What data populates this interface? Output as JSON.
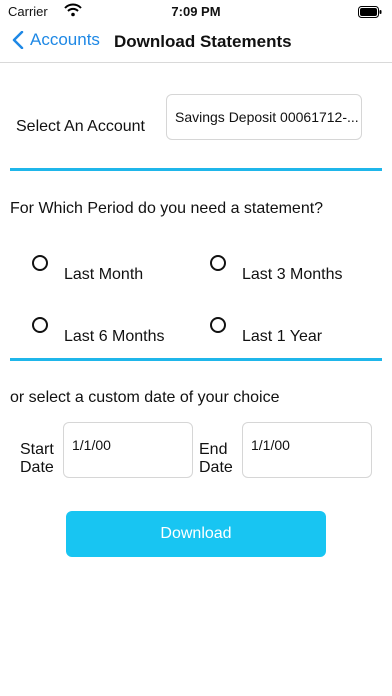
{
  "status_bar": {
    "carrier": "Carrier",
    "time": "7:09 PM"
  },
  "nav": {
    "back_label": "Accounts",
    "title": "Download Statements"
  },
  "account": {
    "label": "Select An Account",
    "value": "Savings Deposit 00061712-..."
  },
  "period": {
    "title": "For Which Period do you need a statement?",
    "options": [
      {
        "label": "Last Month",
        "selected": false
      },
      {
        "label": "Last 3 Months",
        "selected": false
      },
      {
        "label": "Last 6 Months",
        "selected": false
      },
      {
        "label": "Last 1 Year",
        "selected": false
      }
    ]
  },
  "custom": {
    "title": "or select a custom date of your choice",
    "start_label_line1": "Start",
    "start_label_line2": "Date",
    "start_value": "1/1/00",
    "end_label_line1": "End",
    "end_label_line2": "Date",
    "end_value": "1/1/00"
  },
  "download_label": "Download",
  "colors": {
    "accent": "#1fb6ea",
    "button": "#18c5f2",
    "link": "#1e88e5"
  }
}
